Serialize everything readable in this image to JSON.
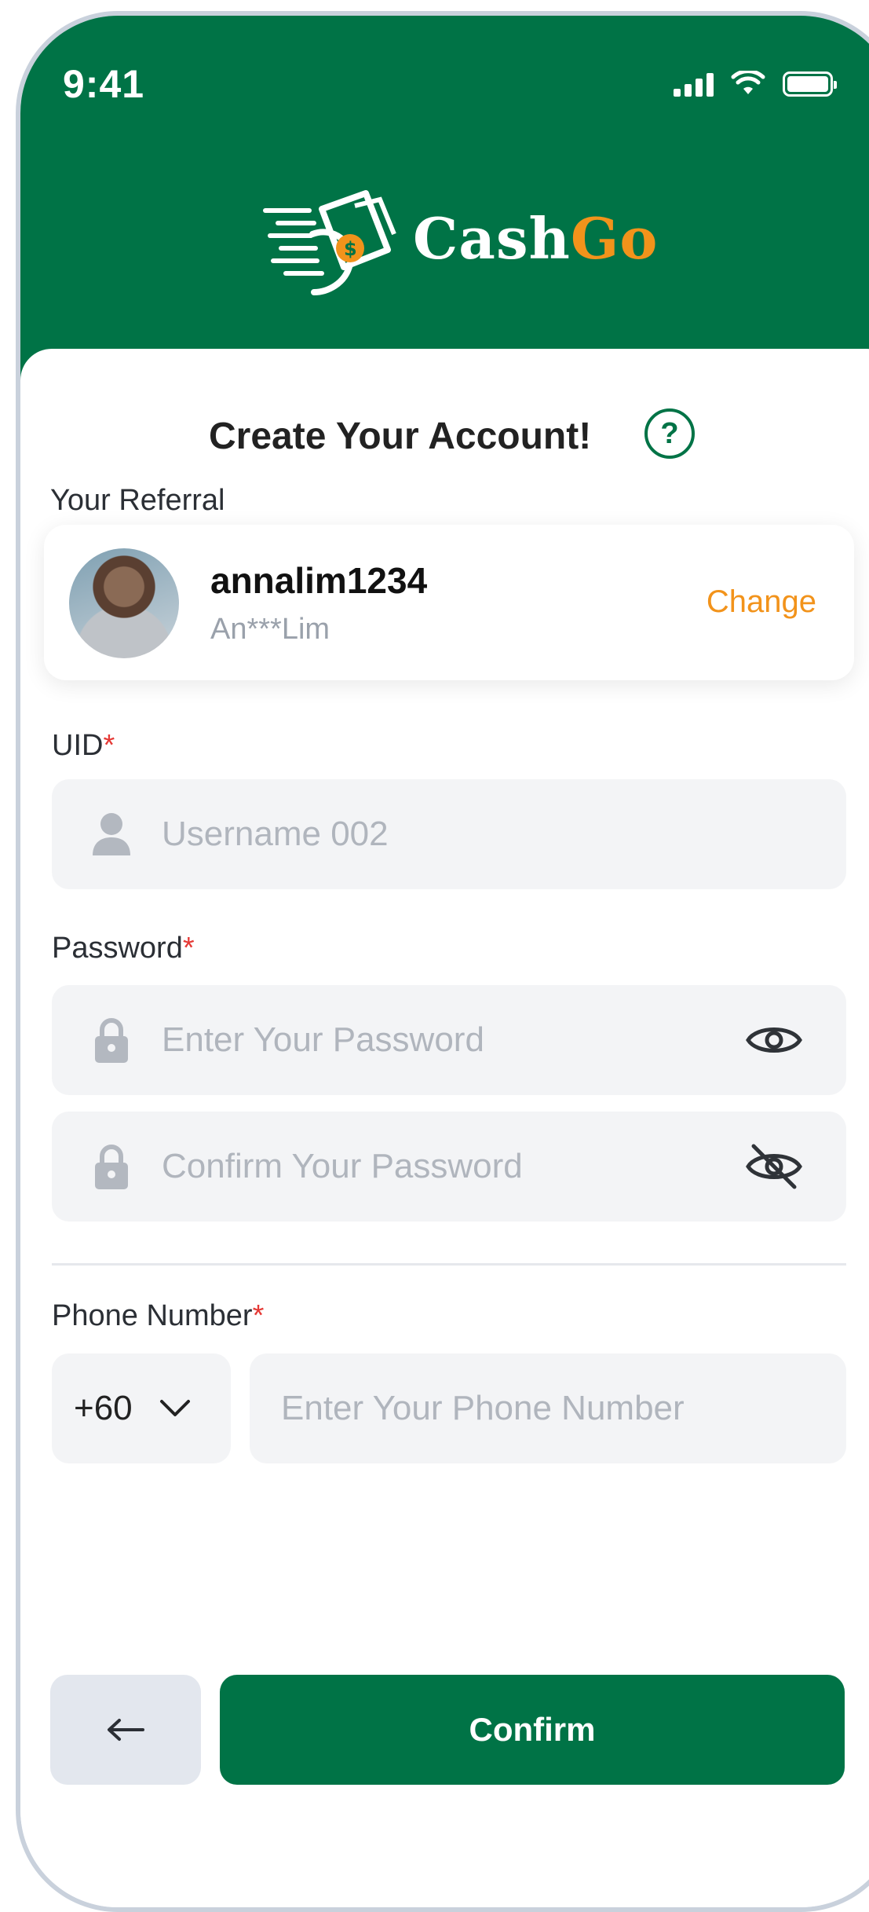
{
  "status_bar": {
    "time": "9:41"
  },
  "brand": {
    "name_part1": "Cash",
    "name_part2": "Go",
    "primary_color": "#007346",
    "accent_color": "#F2931B"
  },
  "page": {
    "title": "Create Your Account!",
    "help_icon": "question-circle-icon"
  },
  "referral": {
    "section_label": "Your Referral",
    "username": "annalim1234",
    "display_name": "An***Lim",
    "change_label": "Change"
  },
  "uid": {
    "label": "UID",
    "required_mark": "*",
    "placeholder": "Username 002",
    "icon": "user-icon"
  },
  "password": {
    "label": "Password",
    "required_mark": "*",
    "placeholder": "Enter Your Password",
    "confirm_placeholder": "Confirm Your Password",
    "show_icon": "eye-icon",
    "hide_icon": "eye-off-icon"
  },
  "phone": {
    "label": "Phone Number",
    "required_mark": "*",
    "country_code": "+60",
    "placeholder": "Enter Your Phone Number"
  },
  "actions": {
    "back_icon": "arrow-left-icon",
    "confirm_label": "Confirm"
  }
}
